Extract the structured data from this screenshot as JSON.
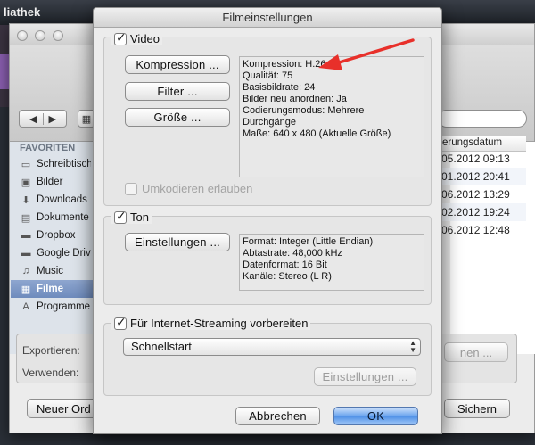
{
  "app": {
    "title": "liathek"
  },
  "save_window": {
    "sidebar_heading": "FAVORITEN",
    "sidebar_items": [
      {
        "label": "Schreibtisch",
        "icon": "desktop-icon"
      },
      {
        "label": "Bilder",
        "icon": "pictures-icon"
      },
      {
        "label": "Downloads",
        "icon": "downloads-icon"
      },
      {
        "label": "Dokumente",
        "icon": "documents-icon"
      },
      {
        "label": "Dropbox",
        "icon": "folder-icon"
      },
      {
        "label": "Google Drive",
        "icon": "folder-icon"
      },
      {
        "label": "Music",
        "icon": "music-icon"
      },
      {
        "label": "Filme",
        "icon": "movies-icon",
        "selected": true
      },
      {
        "label": "Programme",
        "icon": "applications-icon"
      }
    ],
    "column_header": "erungsdatum",
    "dates": [
      "05.2012 09:13",
      "01.2012 20:41",
      "06.2012 13:29",
      "02.2012 19:24",
      "06.2012 12:48"
    ],
    "export_label": "Exportieren:",
    "use_label": "Verwenden:",
    "options_button": "nen ...",
    "new_folder_button": "Neuer Ord",
    "save_button": "Sichern",
    "nav_back": "◀",
    "nav_forward": "▶",
    "view_icon": "▦"
  },
  "sheet": {
    "title": "Filmeinstellungen",
    "video": {
      "label": "Video",
      "checked": true,
      "buttons": {
        "compression": "Kompression ...",
        "filter": "Filter ...",
        "size": "Größe ..."
      },
      "info": [
        "Kompression: H.264",
        "Qualität: 75",
        "Basisbildrate: 24",
        "Bilder neu anordnen: Ja",
        "Codierungsmodus: Mehrere",
        "Durchgänge",
        "Maße: 640 x 480 (Aktuelle Größe)"
      ],
      "reencode_label": "Umkodieren erlauben"
    },
    "sound": {
      "label": "Ton",
      "checked": true,
      "settings_button": "Einstellungen ...",
      "info": [
        "Format: Integer (Little Endian)",
        "Abtastrate: 48,000 kHz",
        "Datenformat: 16 Bit",
        "Kanäle: Stereo (L R)"
      ]
    },
    "streaming": {
      "label": "Für Internet-Streaming vorbereiten",
      "checked": true,
      "selected_option": "Schnellstart",
      "settings_button": "Einstellungen ..."
    },
    "cancel_button": "Abbrechen",
    "ok_button": "OK"
  },
  "colors": {
    "annotation_arrow": "#e8302a",
    "primary_button": "#4d8fe6",
    "selection": "#7890c4"
  }
}
